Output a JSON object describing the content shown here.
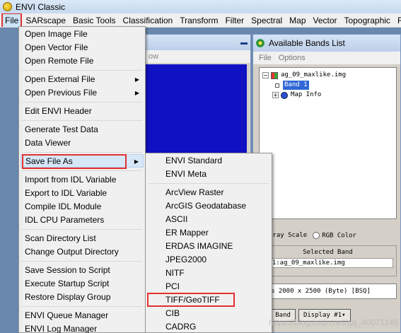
{
  "window": {
    "title": "ENVI Classic"
  },
  "menubar": [
    "File",
    "SARscape",
    "Basic Tools",
    "Classification",
    "Transform",
    "Filter",
    "Spectral",
    "Map",
    "Vector",
    "Topographic",
    "Ra"
  ],
  "background_window": {
    "menu_fragment": "ow"
  },
  "file_menu": {
    "items": [
      {
        "label": "Open Image File"
      },
      {
        "label": "Open Vector File"
      },
      {
        "label": "Open Remote File"
      },
      {
        "label": "Open External File",
        "submenu": true
      },
      {
        "label": "Open Previous File",
        "submenu": true
      },
      {
        "label": "Edit ENVI Header"
      },
      {
        "label": "Generate Test Data"
      },
      {
        "label": "Data Viewer"
      },
      {
        "label": "Save File As",
        "submenu": true
      },
      {
        "label": "Import from IDL Variable"
      },
      {
        "label": "Export to IDL Variable"
      },
      {
        "label": "Compile IDL Module"
      },
      {
        "label": "IDL CPU Parameters"
      },
      {
        "label": "Scan Directory List"
      },
      {
        "label": "Change Output Directory"
      },
      {
        "label": "Save Session to Script"
      },
      {
        "label": "Execute Startup Script"
      },
      {
        "label": "Restore Display Group"
      },
      {
        "label": "ENVI Queue Manager"
      },
      {
        "label": "ENVI Log Manager"
      }
    ]
  },
  "save_as_submenu": {
    "items": [
      {
        "label": "ENVI Standard"
      },
      {
        "label": "ENVI Meta"
      },
      {
        "label": "ArcView Raster"
      },
      {
        "label": "ArcGIS Geodatabase"
      },
      {
        "label": "ASCII"
      },
      {
        "label": "ER Mapper"
      },
      {
        "label": "ERDAS IMAGINE"
      },
      {
        "label": "JPEG2000"
      },
      {
        "label": "NITF"
      },
      {
        "label": "PCI"
      },
      {
        "label": "TIFF/GeoTIFF"
      },
      {
        "label": "CIB"
      },
      {
        "label": "CADRG"
      }
    ]
  },
  "bands_window": {
    "title": "Available Bands List",
    "menu": [
      "File",
      "Options"
    ],
    "tree": {
      "file": "ag_09_maxlike.img",
      "band": "Band 1",
      "map_info": "Map Info"
    },
    "radio": {
      "gray": "Gray Scale",
      "rgb": "RGB Color"
    },
    "selected_band_header": "Selected Band",
    "selected_band_value": "d 1:ag_09_maxlike.img",
    "dims": "s 2000 x 2500 (Byte) [BSQ]",
    "load_button": "ad Band",
    "display_button": "Display #1▾"
  },
  "watermark": "https://blog.csdn.net/qq_40071146",
  "colors": {
    "highlight_box": "#e53030",
    "image_canvas": "#1111c4",
    "selection": "#3168d6"
  }
}
